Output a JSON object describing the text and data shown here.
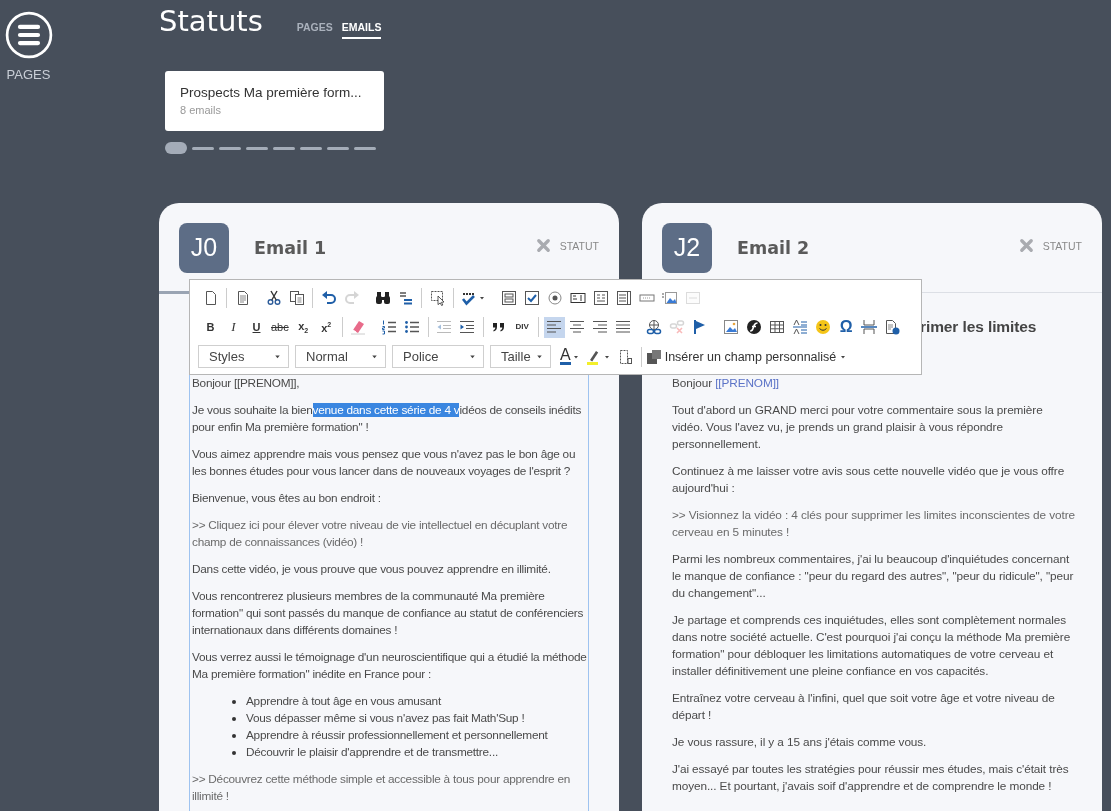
{
  "sidebar": {
    "menu_label": "PAGES"
  },
  "header": {
    "title": "Statuts",
    "tabs": [
      {
        "label": "PAGES",
        "selected": false
      },
      {
        "label": "EMAILS",
        "selected": true
      }
    ]
  },
  "sequences": [
    {
      "name": "Prospects Ma première form...",
      "count": "8 emails"
    }
  ],
  "pager": [
    {
      "selected": true
    },
    {
      "selected": false
    },
    {
      "selected": false
    },
    {
      "selected": false
    },
    {
      "selected": false
    },
    {
      "selected": false
    },
    {
      "selected": false
    },
    {
      "selected": false
    }
  ],
  "toolbar": {
    "rows": [
      {
        "buttons": [
          {
            "kind": "icon",
            "disabled": false
          },
          {
            "kind": "separator"
          },
          {
            "kind": "icon",
            "disabled": false
          },
          {
            "kind": "gap"
          },
          {
            "kind": "icon",
            "disabled": false
          },
          {
            "kind": "icon",
            "disabled": false
          },
          {
            "kind": "separator"
          },
          {
            "kind": "icon",
            "disabled": false
          },
          {
            "kind": "icon",
            "disabled": true
          },
          {
            "kind": "gap"
          },
          {
            "kind": "icon",
            "disabled": false
          },
          {
            "kind": "icon",
            "disabled": false
          },
          {
            "kind": "separator"
          },
          {
            "kind": "icon",
            "disabled": false
          },
          {
            "kind": "separator"
          },
          {
            "kind": "icon",
            "disabled": false
          },
          {
            "kind": "gap"
          },
          {
            "kind": "icon",
            "disabled": false
          },
          {
            "kind": "icon",
            "disabled": false
          },
          {
            "kind": "icon",
            "disabled": false
          },
          {
            "kind": "icon",
            "disabled": false
          },
          {
            "kind": "icon",
            "disabled": false
          },
          {
            "kind": "icon",
            "disabled": false
          },
          {
            "kind": "icon",
            "disabled": false
          },
          {
            "kind": "icon",
            "disabled": false
          },
          {
            "kind": "icon",
            "disabled": true
          }
        ]
      },
      {
        "buttons": [
          {
            "kind": "glyph",
            "label": "B",
            "disabled": false
          },
          {
            "kind": "glyph",
            "label": "I",
            "disabled": false
          },
          {
            "kind": "glyph",
            "label": "U",
            "disabled": false
          },
          {
            "kind": "glyph",
            "label": "abc",
            "disabled": false
          },
          {
            "kind": "glyph",
            "label": "x$_{2}$",
            "disabled": false
          },
          {
            "kind": "glyph",
            "label": "x$^{2}$",
            "disabled": false
          },
          {
            "kind": "separator"
          },
          {
            "kind": "icon",
            "disabled": false
          },
          {
            "kind": "gap"
          },
          {
            "kind": "icon",
            "disabled": false
          },
          {
            "kind": "icon",
            "disabled": false
          },
          {
            "kind": "separator"
          },
          {
            "kind": "icon",
            "disabled": true
          },
          {
            "kind": "icon",
            "disabled": false
          },
          {
            "kind": "separator"
          },
          {
            "kind": "icon",
            "disabled": false
          },
          {
            "kind": "glyph",
            "label": "DIV",
            "disabled": false
          },
          {
            "kind": "separator"
          },
          {
            "kind": "icon",
            "disabled": false,
            "selected": true
          },
          {
            "kind": "icon",
            "disabled": false,
            "selected": false
          },
          {
            "kind": "icon",
            "disabled": false,
            "selected": false
          },
          {
            "kind": "icon",
            "disabled": false,
            "selected": false
          },
          {
            "kind": "gap"
          },
          {
            "kind": "icon",
            "disabled": false
          },
          {
            "kind": "icon",
            "disabled": true
          },
          {
            "kind": "icon",
            "disabled": false
          },
          {
            "kind": "gap"
          },
          {
            "kind": "icon",
            "disabled": false
          },
          {
            "kind": "icon",
            "disabled": false
          },
          {
            "kind": "icon",
            "disabled": false
          },
          {
            "kind": "icon",
            "disabled": false
          },
          {
            "kind": "icon",
            "disabled": false
          },
          {
            "kind": "glyph",
            "label": "Ω",
            "disabled": false
          },
          {
            "kind": "icon",
            "disabled": false
          },
          {
            "kind": "icon",
            "disabled": false
          }
        ]
      },
      {
        "buttons": [
          {
            "kind": "dropdown",
            "label": "Styles"
          },
          {
            "kind": "dropdown",
            "label": "Normal"
          },
          {
            "kind": "dropdown",
            "label": "Police"
          },
          {
            "kind": "dropdown",
            "label": "Taille"
          },
          {
            "kind": "glyph",
            "label": "A",
            "disabled": false
          },
          {
            "kind": "icon",
            "disabled": false
          },
          {
            "kind": "icon",
            "disabled": false
          },
          {
            "kind": "separator"
          },
          {
            "kind": "menu",
            "label": "Insérer un champ personnalisé"
          }
        ]
      }
    ]
  },
  "emails": [
    {
      "avatar": "J0",
      "title": "Email 1",
      "status": "STATUT",
      "editing": true,
      "blocks": [
        {
          "kind": "text",
          "text": "Bonjour [[PRENOM]],"
        },
        {
          "kind": "selection",
          "before": "Je vous souhaite la bien",
          "highlight": "venue dans cette série de 4 v",
          "after": "idéos de conseils inédits pour enfin Ma première formation\" !"
        },
        {
          "kind": "text",
          "text": "Vous aimez apprendre mais vous pensez que vous n'avez pas le bon âge ou les bonnes études pour vous lancer dans de nouveaux voyages de l'esprit ?"
        },
        {
          "kind": "text",
          "text": "Bienvenue, vous êtes au bon endroit :"
        },
        {
          "kind": "link",
          "text": ">> Cliquez ici pour élever votre niveau de vie intellectuel en décuplant votre champ de connaissances (vidéo) !"
        },
        {
          "kind": "text",
          "text": "Dans cette vidéo, je vous prouve que vous pouvez apprendre en illimité."
        },
        {
          "kind": "text",
          "text": "Vous rencontrerez plusieurs membres de la communauté Ma première formation\" qui sont passés du manque de confiance au statut de conférenciers internationaux dans différents domaines !"
        },
        {
          "kind": "text",
          "text": "Vous verrez aussi le témoignage d'un neuroscientifique qui a étudié la méthode Ma première formation\" inédite en France pour :"
        },
        {
          "kind": "list",
          "items": [
            "Apprendre à tout âge en vous amusant",
            "Vous dépasser même si vous n'avez pas fait Math'Sup !",
            "Apprendre à réussir professionnellement et personnellement",
            "Découvrir le plaisir d'apprendre et de transmettre..."
          ]
        },
        {
          "kind": "link",
          "text": ">> Découvrez cette méthode simple et accessible à tous pour apprendre en illimité !"
        }
      ]
    },
    {
      "avatar": "J2",
      "title": "Email 2",
      "status": "STATUT",
      "editing": false,
      "heading": "rimer les limites",
      "blocks": [
        {
          "kind": "greeting",
          "text": "Bonjour",
          "field": "[[PRENOM]]"
        },
        {
          "kind": "text",
          "text": "Tout d'abord un GRAND merci pour votre commentaire sous la première vidéo. Vous l'avez vu, je prends un grand plaisir à vous répondre personnellement."
        },
        {
          "kind": "text",
          "text": "Continuez à me laisser votre avis sous cette nouvelle vidéo que je vous offre aujourd'hui :"
        },
        {
          "kind": "link",
          "text": ">> Visionnez la vidéo : 4 clés pour supprimer les limites inconscientes de votre cerveau en 5 minutes !"
        },
        {
          "kind": "text",
          "text": "Parmi les nombreux commentaires, j'ai lu beaucoup d'inquiétudes concernant le manque de confiance : \"peur du regard des autres\", \"peur du ridicule\", \"peur du changement\"..."
        },
        {
          "kind": "text",
          "text": "Je partage et comprends ces inquiétudes, elles sont complètement normales dans notre société actuelle. C'est pourquoi j'ai conçu la méthode Ma première formation\" pour débloquer les limitations automatiques de votre cerveau et installer définitivement une pleine confiance en vos capacités."
        },
        {
          "kind": "text",
          "text": "Entraînez votre cerveau à l'infini, quel que soit votre âge et votre niveau de départ !"
        },
        {
          "kind": "text",
          "text": "Je vous rassure, il y a 15 ans j'étais comme vous."
        },
        {
          "kind": "text",
          "text": "J'ai essayé par toutes les stratégies pour réussir mes études, mais c'était très moyen... Et pourtant, j'avais soif d'apprendre et de comprendre le monde !"
        }
      ]
    }
  ]
}
